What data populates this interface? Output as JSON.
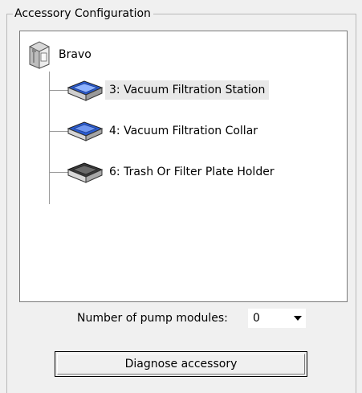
{
  "groupbox": {
    "title": "Accessory Configuration"
  },
  "tree": {
    "root": {
      "label": "Bravo",
      "icon": "bravo-device-icon"
    },
    "children": [
      {
        "label": "3: Vacuum Filtration Station",
        "icon": "vacuum-filtration-station-icon",
        "selected": true
      },
      {
        "label": "4: Vacuum Filtration Collar",
        "icon": "vacuum-filtration-collar-icon",
        "selected": false
      },
      {
        "label": "6: Trash Or Filter Plate Holder",
        "icon": "filter-plate-holder-icon",
        "selected": false
      }
    ]
  },
  "pump": {
    "label": "Number of pump modules:",
    "value": "0"
  },
  "button": {
    "label": "Diagnose accessory"
  },
  "colors": {
    "background": "#f0f0f0",
    "selection": "#e8e8e8",
    "border": "#7a7a7a",
    "accent_blue": "#1e4fb8"
  }
}
